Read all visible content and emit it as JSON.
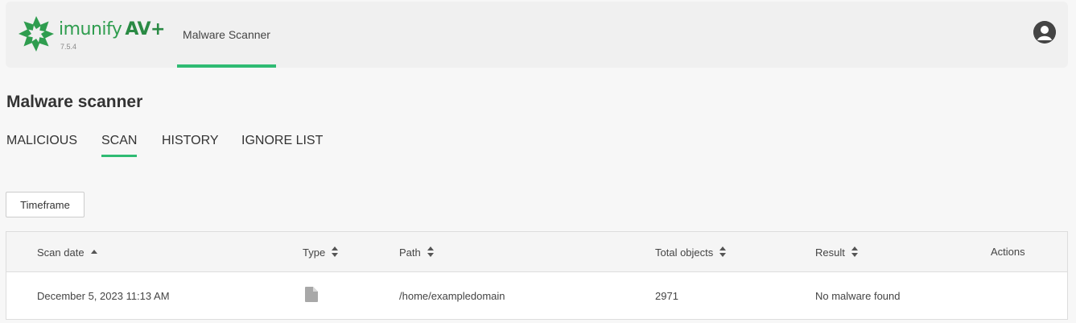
{
  "header": {
    "logo": {
      "name": "imunify",
      "suffix": "AV+",
      "version": "7.5.4"
    },
    "nav_tab": "Malware Scanner"
  },
  "page": {
    "title": "Malware scanner"
  },
  "tabs": [
    {
      "label": "MALICIOUS",
      "active": false
    },
    {
      "label": "SCAN",
      "active": true
    },
    {
      "label": "HISTORY",
      "active": false
    },
    {
      "label": "IGNORE LIST",
      "active": false
    }
  ],
  "filters": {
    "timeframe_label": "Timeframe"
  },
  "table": {
    "columns": [
      {
        "label": "Scan date",
        "sort": "asc"
      },
      {
        "label": "Type",
        "sort": "both"
      },
      {
        "label": "Path",
        "sort": "both"
      },
      {
        "label": "Total objects",
        "sort": "both"
      },
      {
        "label": "Result",
        "sort": "both"
      },
      {
        "label": "Actions",
        "sort": "none"
      }
    ],
    "rows": [
      {
        "scan_date": "December 5, 2023 11:13 AM",
        "type_icon": "file-icon",
        "path": "/home/exampledomain",
        "total_objects": "2971",
        "result": "No malware found"
      }
    ]
  },
  "colors": {
    "accent": "#2fbb73",
    "brand": "#2f9d4f"
  }
}
